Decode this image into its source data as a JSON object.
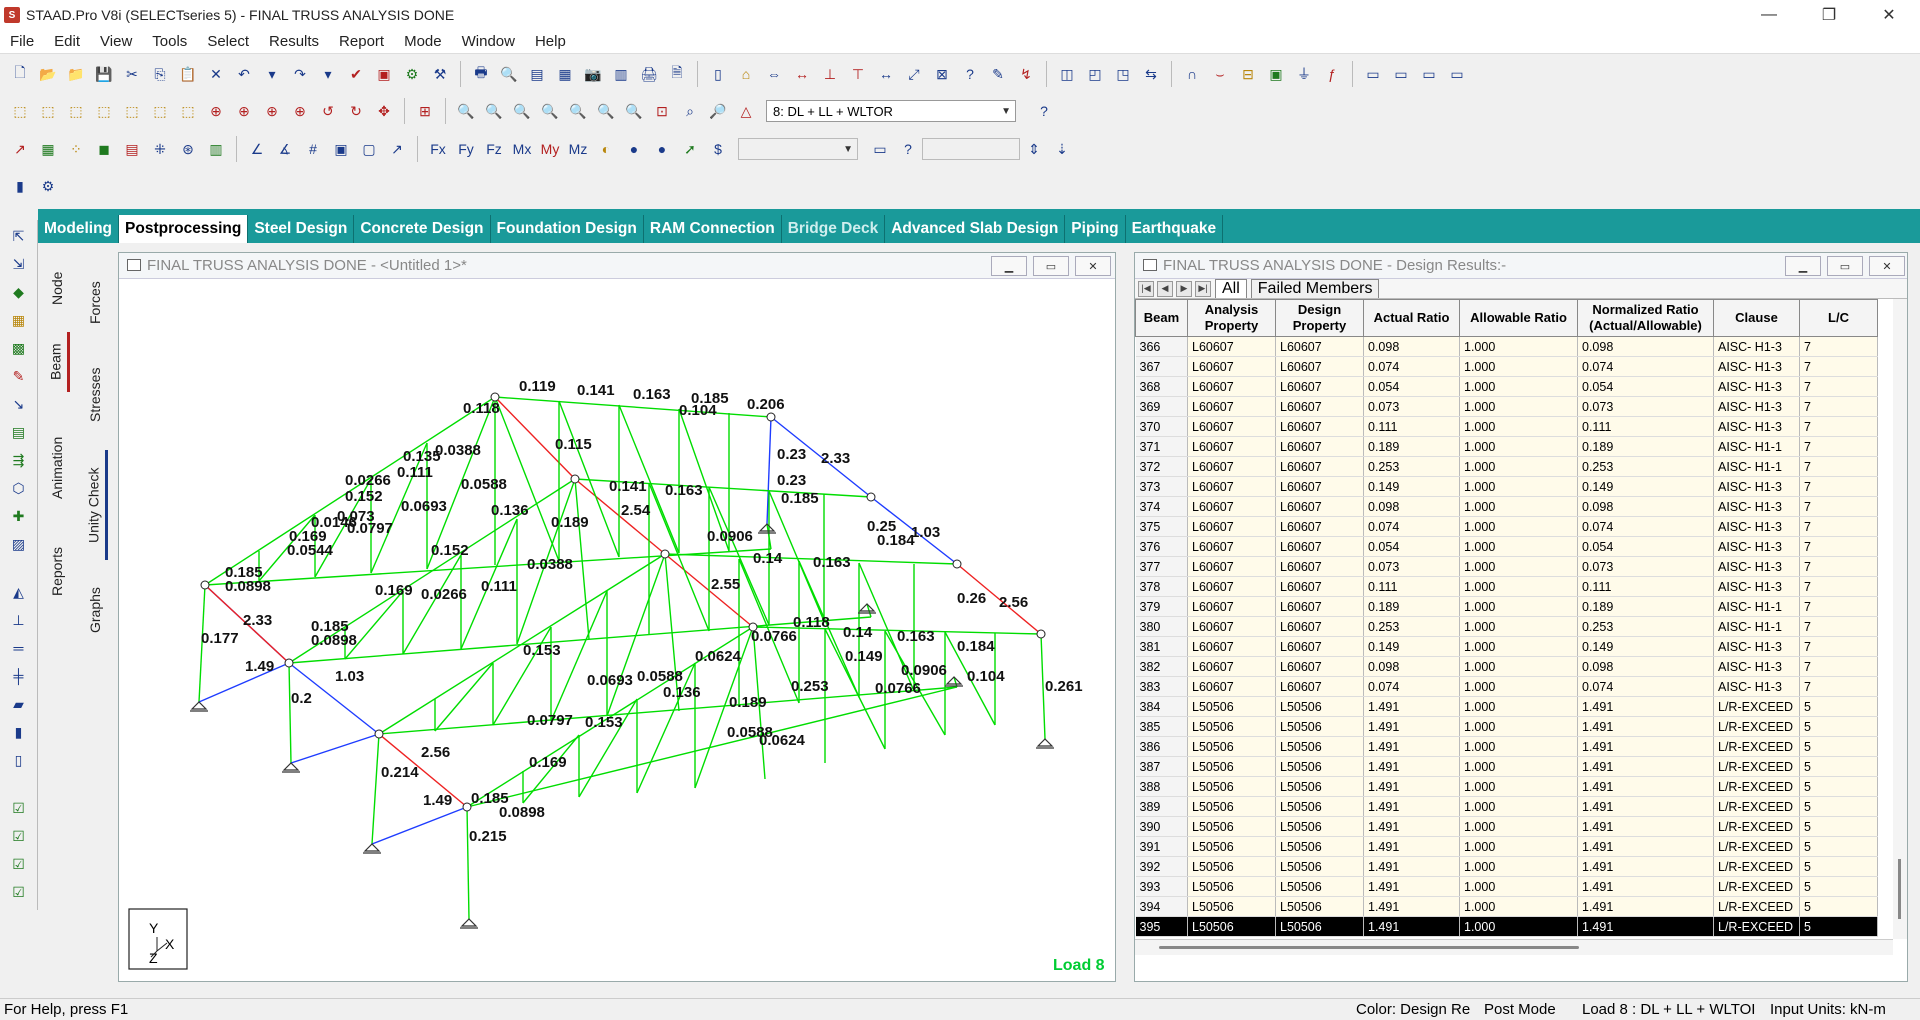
{
  "app": {
    "title": "STAAD.Pro V8i (SELECTseries 5) - FINAL TRUSS ANALYSIS DONE"
  },
  "menu": [
    "File",
    "Edit",
    "View",
    "Tools",
    "Select",
    "Results",
    "Report",
    "Mode",
    "Window",
    "Help"
  ],
  "load_combo": "8: DL + LL + WLTOR",
  "modes": [
    "Modeling",
    "Postprocessing",
    "Steel Design",
    "Concrete Design",
    "Foundation Design",
    "RAM Connection",
    "Bridge Deck",
    "Advanced Slab Design",
    "Piping",
    "Earthquake"
  ],
  "active_mode": "Postprocessing",
  "side_tabs_a": [
    "Node",
    "Beam",
    "Animation",
    "Reports"
  ],
  "side_tabs_b": [
    "Forces",
    "Stresses",
    "Unity Check",
    "Graphs"
  ],
  "viewport": {
    "title": "FINAL TRUSS ANALYSIS DONE - <Untitled 1>*",
    "load_label": "Load 8",
    "labels": {
      "a1": "0.119",
      "a2": "0.141",
      "a3": "0.163",
      "a4": "0.185",
      "a5": "0.206",
      "a6": "0.118",
      "a7": "2.33",
      "a8": "0.135",
      "a9": "0.152",
      "a10": "0.169",
      "a11": "0.185",
      "a12": "0.0898",
      "a13": "2.33",
      "a14": "0.177",
      "a15": "1.49",
      "a16": "0.2",
      "a17": "1.03",
      "a18": "2.56",
      "a19": "0.214",
      "a20": "1.49",
      "a21": "0.215",
      "a22": "0.261",
      "a23": "1.03",
      "a24": "2.56",
      "a25": "0.0906",
      "a26": "0.104",
      "a27": "0.23",
      "a28": "0.25",
      "a29": "0.26",
      "a30": "0.184",
      "a31": "0.0388",
      "a32": "0.0588",
      "a33": "0.0693",
      "a34": "0.0797",
      "a35": "0.136",
      "a36": "0.189",
      "a37": "0.111",
      "a38": "0.0266",
      "a39": "0.073",
      "a40": "0.0146",
      "a41": "0.0544",
      "a42": "0.152",
      "a43": "0.169",
      "a44": "0.185",
      "a45": "0.0898",
      "a46": "0.153",
      "a47": "0.14",
      "a48": "0.163",
      "a49": "2.54",
      "a50": "2.55",
      "a51": "0.0766",
      "a52": "0.0624",
      "a53": "0.0588",
      "a54": "0.136",
      "a55": "0.189",
      "a56": "0.153",
      "a57": "0.169",
      "a58": "0.185",
      "a59": "0.0898",
      "a60": "0.0588",
      "a61": "0.0624",
      "a62": "0.0766",
      "a63": "0.0693",
      "a64": "0.0797",
      "a65": "0.14",
      "a66": "0.163",
      "a67": "0.184",
      "a68": "0.104",
      "a69": "0.0906",
      "a70": "0.253",
      "a71": "0.149",
      "a72": "0.118",
      "a73": "0.115",
      "a74": "0.141",
      "a75": "0.163",
      "a76": "0.185",
      "a77": "0.23",
      "a78": "0.0388",
      "a79": "0.111",
      "a80": "0.0266"
    }
  },
  "results": {
    "title": "FINAL TRUSS ANALYSIS DONE - Design Results:-",
    "tabs": [
      "All",
      "Failed Members"
    ],
    "columns": [
      "Beam",
      "Analysis Property",
      "Design Property",
      "Actual Ratio",
      "Allowable Ratio",
      "Normalized Ratio (Actual/Allowable)",
      "Clause",
      "L/C"
    ],
    "rows": [
      [
        "366",
        "L60607",
        "L60607",
        "0.098",
        "1.000",
        "0.098",
        "AISC- H1-3",
        "7"
      ],
      [
        "367",
        "L60607",
        "L60607",
        "0.074",
        "1.000",
        "0.074",
        "AISC- H1-3",
        "7"
      ],
      [
        "368",
        "L60607",
        "L60607",
        "0.054",
        "1.000",
        "0.054",
        "AISC- H1-3",
        "7"
      ],
      [
        "369",
        "L60607",
        "L60607",
        "0.073",
        "1.000",
        "0.073",
        "AISC- H1-3",
        "7"
      ],
      [
        "370",
        "L60607",
        "L60607",
        "0.111",
        "1.000",
        "0.111",
        "AISC- H1-3",
        "7"
      ],
      [
        "371",
        "L60607",
        "L60607",
        "0.189",
        "1.000",
        "0.189",
        "AISC- H1-1",
        "7"
      ],
      [
        "372",
        "L60607",
        "L60607",
        "0.253",
        "1.000",
        "0.253",
        "AISC- H1-1",
        "7"
      ],
      [
        "373",
        "L60607",
        "L60607",
        "0.149",
        "1.000",
        "0.149",
        "AISC- H1-3",
        "7"
      ],
      [
        "374",
        "L60607",
        "L60607",
        "0.098",
        "1.000",
        "0.098",
        "AISC- H1-3",
        "7"
      ],
      [
        "375",
        "L60607",
        "L60607",
        "0.074",
        "1.000",
        "0.074",
        "AISC- H1-3",
        "7"
      ],
      [
        "376",
        "L60607",
        "L60607",
        "0.054",
        "1.000",
        "0.054",
        "AISC- H1-3",
        "7"
      ],
      [
        "377",
        "L60607",
        "L60607",
        "0.073",
        "1.000",
        "0.073",
        "AISC- H1-3",
        "7"
      ],
      [
        "378",
        "L60607",
        "L60607",
        "0.111",
        "1.000",
        "0.111",
        "AISC- H1-3",
        "7"
      ],
      [
        "379",
        "L60607",
        "L60607",
        "0.189",
        "1.000",
        "0.189",
        "AISC- H1-1",
        "7"
      ],
      [
        "380",
        "L60607",
        "L60607",
        "0.253",
        "1.000",
        "0.253",
        "AISC- H1-1",
        "7"
      ],
      [
        "381",
        "L60607",
        "L60607",
        "0.149",
        "1.000",
        "0.149",
        "AISC- H1-3",
        "7"
      ],
      [
        "382",
        "L60607",
        "L60607",
        "0.098",
        "1.000",
        "0.098",
        "AISC- H1-3",
        "7"
      ],
      [
        "383",
        "L60607",
        "L60607",
        "0.074",
        "1.000",
        "0.074",
        "AISC- H1-3",
        "7"
      ],
      [
        "384",
        "L50506",
        "L50506",
        "1.491",
        "1.000",
        "1.491",
        "L/R-EXCEED",
        "5"
      ],
      [
        "385",
        "L50506",
        "L50506",
        "1.491",
        "1.000",
        "1.491",
        "L/R-EXCEED",
        "5"
      ],
      [
        "386",
        "L50506",
        "L50506",
        "1.491",
        "1.000",
        "1.491",
        "L/R-EXCEED",
        "5"
      ],
      [
        "387",
        "L50506",
        "L50506",
        "1.491",
        "1.000",
        "1.491",
        "L/R-EXCEED",
        "5"
      ],
      [
        "388",
        "L50506",
        "L50506",
        "1.491",
        "1.000",
        "1.491",
        "L/R-EXCEED",
        "5"
      ],
      [
        "389",
        "L50506",
        "L50506",
        "1.491",
        "1.000",
        "1.491",
        "L/R-EXCEED",
        "5"
      ],
      [
        "390",
        "L50506",
        "L50506",
        "1.491",
        "1.000",
        "1.491",
        "L/R-EXCEED",
        "5"
      ],
      [
        "391",
        "L50506",
        "L50506",
        "1.491",
        "1.000",
        "1.491",
        "L/R-EXCEED",
        "5"
      ],
      [
        "392",
        "L50506",
        "L50506",
        "1.491",
        "1.000",
        "1.491",
        "L/R-EXCEED",
        "5"
      ],
      [
        "393",
        "L50506",
        "L50506",
        "1.491",
        "1.000",
        "1.491",
        "L/R-EXCEED",
        "5"
      ],
      [
        "394",
        "L50506",
        "L50506",
        "1.491",
        "1.000",
        "1.491",
        "L/R-EXCEED",
        "5"
      ],
      [
        "395",
        "L50506",
        "L50506",
        "1.491",
        "1.000",
        "1.491",
        "L/R-EXCEED",
        "5"
      ]
    ],
    "selected_beam": "395"
  },
  "status": {
    "help": "For Help, press F1",
    "color": "Color: Design Re",
    "mode": "Post Mode",
    "load": "Load 8 : DL + LL + WLTOI",
    "units": "Input Units:  kN-m"
  },
  "colors": {
    "accent": "#1a9a9a",
    "member_ok": "#00dd00",
    "member_fail": "#1e3cff",
    "member_red": "#ee2222"
  }
}
